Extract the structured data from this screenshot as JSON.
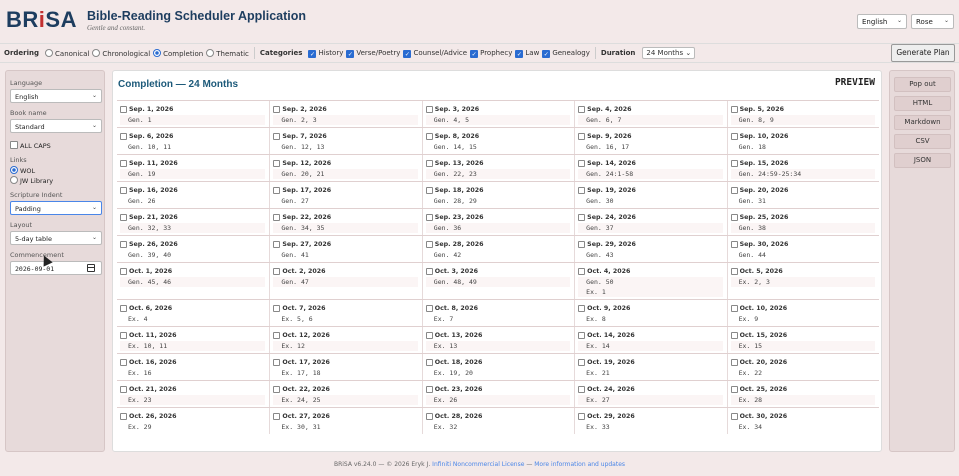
{
  "app": {
    "logo_main": "BR",
    "logo_accent": "i",
    "logo_tail": "SA",
    "title": "Bible-Reading Scheduler Application",
    "subtitle": "Gentle and constant.",
    "language": "English",
    "user": "Rose"
  },
  "toolbar": {
    "ordering_label": "Ordering",
    "orderings": [
      {
        "label": "Canonical",
        "checked": false
      },
      {
        "label": "Chronological",
        "checked": false
      },
      {
        "label": "Completion",
        "checked": true
      },
      {
        "label": "Thematic",
        "checked": false
      }
    ],
    "categories_label": "Categories",
    "categories": [
      {
        "label": "History",
        "checked": true
      },
      {
        "label": "Verse/Poetry",
        "checked": true
      },
      {
        "label": "Counsel/Advice",
        "checked": true
      },
      {
        "label": "Prophecy",
        "checked": true
      },
      {
        "label": "Law",
        "checked": true
      },
      {
        "label": "Genealogy",
        "checked": true
      }
    ],
    "duration_label": "Duration",
    "duration_value": "24 Months",
    "generate_label": "Generate Plan"
  },
  "sidebar": {
    "language_label": "Language",
    "language_value": "English",
    "book_name_label": "Book name",
    "book_name_value": "Standard",
    "all_caps_label": "ALL CAPS",
    "links_label": "Links",
    "link_wol": "WOL",
    "link_jw": "JW Library",
    "indent_label": "Scripture Indent",
    "indent_value": "Padding",
    "layout_label": "Layout",
    "layout_value": "5-day table",
    "commencement_label": "Commencement",
    "commencement_value": "2026-09-01"
  },
  "main": {
    "title": "Completion — 24 Months",
    "preview_label": "PREVIEW",
    "rows": [
      [
        {
          "date": "Sep. 1, 2026",
          "r": [
            "Gen. 1"
          ]
        },
        {
          "date": "Sep. 2, 2026",
          "r": [
            "Gen. 2, 3"
          ]
        },
        {
          "date": "Sep. 3, 2026",
          "r": [
            "Gen. 4, 5"
          ]
        },
        {
          "date": "Sep. 4, 2026",
          "r": [
            "Gen. 6, 7"
          ]
        },
        {
          "date": "Sep. 5, 2026",
          "r": [
            "Gen. 8, 9"
          ]
        }
      ],
      [
        {
          "date": "Sep. 6, 2026",
          "r": [
            "Gen. 10, 11"
          ]
        },
        {
          "date": "Sep. 7, 2026",
          "r": [
            "Gen. 12, 13"
          ]
        },
        {
          "date": "Sep. 8, 2026",
          "r": [
            "Gen. 14, 15"
          ]
        },
        {
          "date": "Sep. 9, 2026",
          "r": [
            "Gen. 16, 17"
          ]
        },
        {
          "date": "Sep. 10, 2026",
          "r": [
            "Gen. 18"
          ]
        }
      ],
      [
        {
          "date": "Sep. 11, 2026",
          "r": [
            "Gen. 19"
          ]
        },
        {
          "date": "Sep. 12, 2026",
          "r": [
            "Gen. 20, 21"
          ]
        },
        {
          "date": "Sep. 13, 2026",
          "r": [
            "Gen. 22, 23"
          ]
        },
        {
          "date": "Sep. 14, 2026",
          "r": [
            "Gen. 24:1-58"
          ]
        },
        {
          "date": "Sep. 15, 2026",
          "r": [
            "Gen. 24:59-25:34"
          ]
        }
      ],
      [
        {
          "date": "Sep. 16, 2026",
          "r": [
            "Gen. 26"
          ]
        },
        {
          "date": "Sep. 17, 2026",
          "r": [
            "Gen. 27"
          ]
        },
        {
          "date": "Sep. 18, 2026",
          "r": [
            "Gen. 28, 29"
          ]
        },
        {
          "date": "Sep. 19, 2026",
          "r": [
            "Gen. 30"
          ]
        },
        {
          "date": "Sep. 20, 2026",
          "r": [
            "Gen. 31"
          ]
        }
      ],
      [
        {
          "date": "Sep. 21, 2026",
          "r": [
            "Gen. 32, 33"
          ]
        },
        {
          "date": "Sep. 22, 2026",
          "r": [
            "Gen. 34, 35"
          ]
        },
        {
          "date": "Sep. 23, 2026",
          "r": [
            "Gen. 36"
          ]
        },
        {
          "date": "Sep. 24, 2026",
          "r": [
            "Gen. 37"
          ]
        },
        {
          "date": "Sep. 25, 2026",
          "r": [
            "Gen. 38"
          ]
        }
      ],
      [
        {
          "date": "Sep. 26, 2026",
          "r": [
            "Gen. 39, 40"
          ]
        },
        {
          "date": "Sep. 27, 2026",
          "r": [
            "Gen. 41"
          ]
        },
        {
          "date": "Sep. 28, 2026",
          "r": [
            "Gen. 42"
          ]
        },
        {
          "date": "Sep. 29, 2026",
          "r": [
            "Gen. 43"
          ]
        },
        {
          "date": "Sep. 30, 2026",
          "r": [
            "Gen. 44"
          ]
        }
      ],
      [
        {
          "date": "Oct. 1, 2026",
          "r": [
            "Gen. 45, 46"
          ]
        },
        {
          "date": "Oct. 2, 2026",
          "r": [
            "Gen. 47"
          ]
        },
        {
          "date": "Oct. 3, 2026",
          "r": [
            "Gen. 48, 49"
          ]
        },
        {
          "date": "Oct. 4, 2026",
          "r": [
            "Gen. 50",
            "Ex. 1"
          ]
        },
        {
          "date": "Oct. 5, 2026",
          "r": [
            "Ex. 2, 3"
          ]
        }
      ],
      [
        {
          "date": "Oct. 6, 2026",
          "r": [
            "Ex. 4"
          ]
        },
        {
          "date": "Oct. 7, 2026",
          "r": [
            "Ex. 5, 6"
          ]
        },
        {
          "date": "Oct. 8, 2026",
          "r": [
            "Ex. 7"
          ]
        },
        {
          "date": "Oct. 9, 2026",
          "r": [
            "Ex. 8"
          ]
        },
        {
          "date": "Oct. 10, 2026",
          "r": [
            "Ex. 9"
          ]
        }
      ],
      [
        {
          "date": "Oct. 11, 2026",
          "r": [
            "Ex. 10, 11"
          ]
        },
        {
          "date": "Oct. 12, 2026",
          "r": [
            "Ex. 12"
          ]
        },
        {
          "date": "Oct. 13, 2026",
          "r": [
            "Ex. 13"
          ]
        },
        {
          "date": "Oct. 14, 2026",
          "r": [
            "Ex. 14"
          ]
        },
        {
          "date": "Oct. 15, 2026",
          "r": [
            "Ex. 15"
          ]
        }
      ],
      [
        {
          "date": "Oct. 16, 2026",
          "r": [
            "Ex. 16"
          ]
        },
        {
          "date": "Oct. 17, 2026",
          "r": [
            "Ex. 17, 18"
          ]
        },
        {
          "date": "Oct. 18, 2026",
          "r": [
            "Ex. 19, 20"
          ]
        },
        {
          "date": "Oct. 19, 2026",
          "r": [
            "Ex. 21"
          ]
        },
        {
          "date": "Oct. 20, 2026",
          "r": [
            "Ex. 22"
          ]
        }
      ],
      [
        {
          "date": "Oct. 21, 2026",
          "r": [
            "Ex. 23"
          ]
        },
        {
          "date": "Oct. 22, 2026",
          "r": [
            "Ex. 24, 25"
          ]
        },
        {
          "date": "Oct. 23, 2026",
          "r": [
            "Ex. 26"
          ]
        },
        {
          "date": "Oct. 24, 2026",
          "r": [
            "Ex. 27"
          ]
        },
        {
          "date": "Oct. 25, 2026",
          "r": [
            "Ex. 28"
          ]
        }
      ],
      [
        {
          "date": "Oct. 26, 2026",
          "r": [
            "Ex. 29"
          ]
        },
        {
          "date": "Oct. 27, 2026",
          "r": [
            "Ex. 30, 31"
          ]
        },
        {
          "date": "Oct. 28, 2026",
          "r": [
            "Ex. 32"
          ]
        },
        {
          "date": "Oct. 29, 2026",
          "r": [
            "Ex. 33"
          ]
        },
        {
          "date": "Oct. 30, 2026",
          "r": [
            "Ex. 34"
          ]
        }
      ]
    ]
  },
  "export": {
    "buttons": [
      "Pop out",
      "HTML",
      "Markdown",
      "CSV",
      "JSON"
    ]
  },
  "footer": {
    "prefix": "BRiSA v6.24.0 — © 2026 Eryk J.",
    "license": "Infiniti Noncommercial License",
    "dash": "—",
    "more": "More information and updates"
  },
  "colors": {
    "brand_blue": "#1d3d5f",
    "brand_red": "#c23030",
    "accent": "#2a6bd1",
    "background": "#f3e9e9"
  }
}
